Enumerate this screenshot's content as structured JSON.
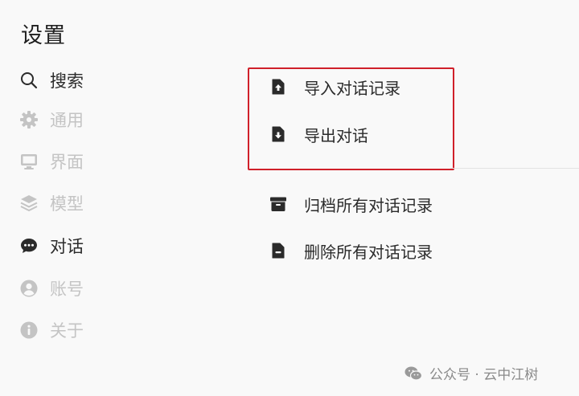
{
  "page": {
    "title": "设置"
  },
  "sidebar": {
    "items": [
      {
        "label": "搜索",
        "icon": "search-icon"
      },
      {
        "label": "通用",
        "icon": "gear-icon"
      },
      {
        "label": "界面",
        "icon": "monitor-icon"
      },
      {
        "label": "模型",
        "icon": "layers-icon"
      },
      {
        "label": "对话",
        "icon": "chat-bubble-icon"
      },
      {
        "label": "账号",
        "icon": "user-circle-icon"
      },
      {
        "label": "关于",
        "icon": "info-icon"
      }
    ],
    "active_label": "对话"
  },
  "main": {
    "actions": [
      {
        "label": "导入对话记录",
        "icon": "file-upload-icon"
      },
      {
        "label": "导出对话",
        "icon": "file-download-icon"
      },
      {
        "label": "归档所有对话记录",
        "icon": "archive-icon"
      },
      {
        "label": "删除所有对话记录",
        "icon": "file-delete-icon"
      }
    ]
  },
  "watermark": {
    "text": "公众号 · 云中江树",
    "icon": "wechat-icon"
  },
  "colors": {
    "highlight_border": "#d0202a",
    "inactive_text": "#c4c4c4",
    "active_text": "#2b2b2b",
    "background": "#f9f9f9"
  }
}
